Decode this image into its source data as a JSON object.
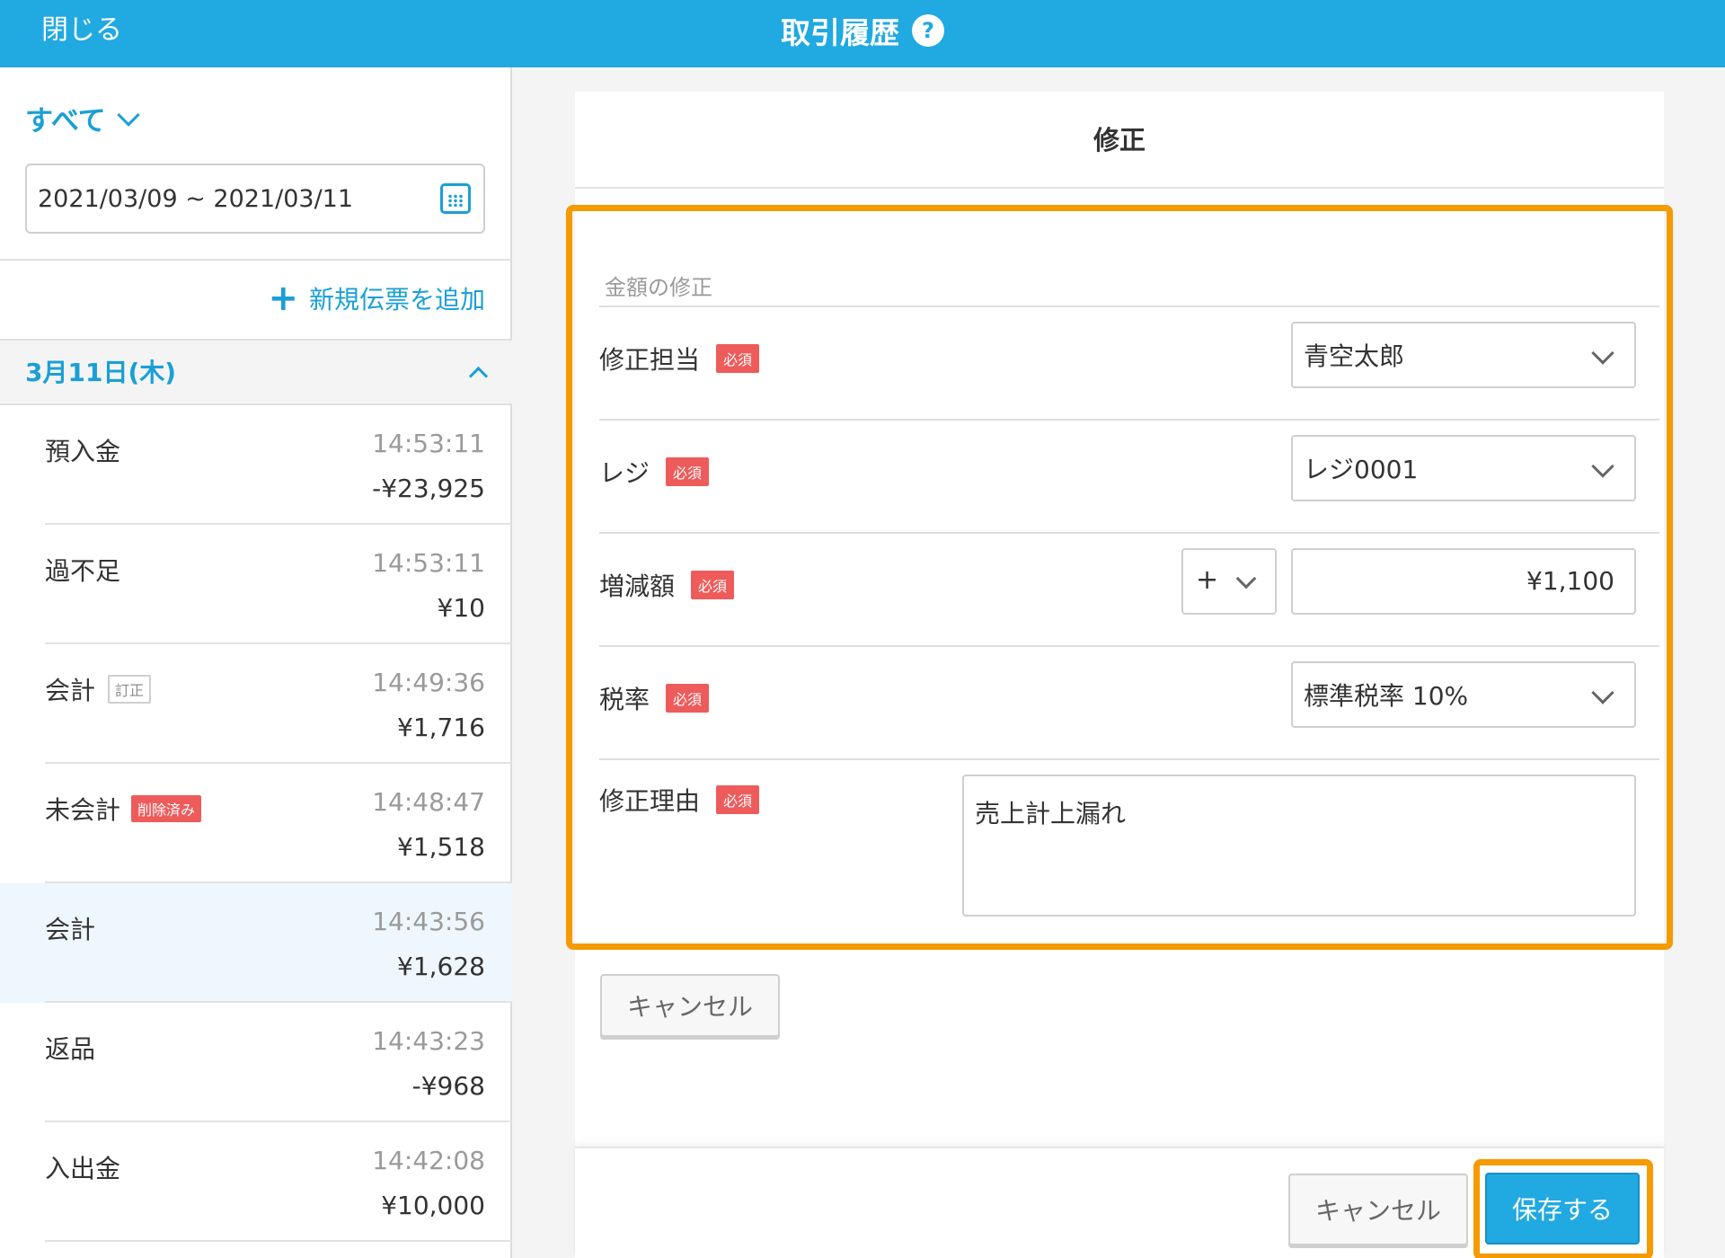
{
  "header": {
    "close_label": "閉じる",
    "title": "取引履歴",
    "help_label": "?"
  },
  "sidebar": {
    "filter_label": "すべて",
    "date_range": "2021/03/09 ~ 2021/03/11",
    "add_voucher_label": "新規伝票を追加",
    "date_group_label": "3月11日(木)",
    "transactions": [
      {
        "name": "預入金",
        "badge": "",
        "time": "14:53:11",
        "amount": "-¥23,925"
      },
      {
        "name": "過不足",
        "badge": "",
        "time": "14:53:11",
        "amount": "¥10"
      },
      {
        "name": "会計",
        "badge": "訂正",
        "time": "14:49:36",
        "amount": "¥1,716"
      },
      {
        "name": "未会計",
        "badge": "削除済み",
        "time": "14:48:47",
        "amount": "¥1,518"
      },
      {
        "name": "会計",
        "badge": "",
        "time": "14:43:56",
        "amount": "¥1,628",
        "selected": true
      },
      {
        "name": "返品",
        "badge": "",
        "time": "14:43:23",
        "amount": "-¥968"
      },
      {
        "name": "入出金",
        "badge": "",
        "time": "14:42:08",
        "amount": "¥10,000"
      }
    ]
  },
  "panel": {
    "title": "修正",
    "section_label": "金額の修正",
    "required_label": "必須",
    "fields": {
      "staff": {
        "label": "修正担当",
        "value": "青空太郎"
      },
      "register": {
        "label": "レジ",
        "value": "レジ0001"
      },
      "adjustment": {
        "label": "増減額",
        "sign": "+",
        "value": "¥1,100"
      },
      "tax_rate": {
        "label": "税率",
        "value": "標準税率 10%"
      },
      "reason": {
        "label": "修正理由",
        "value": "売上計上漏れ"
      }
    },
    "cancel_inline_label": "キャンセル",
    "footer": {
      "cancel_label": "キャンセル",
      "save_label": "保存する"
    }
  },
  "colors": {
    "accent": "#21a9e1",
    "highlight": "#f59a00",
    "required": "#ee5b5b"
  }
}
